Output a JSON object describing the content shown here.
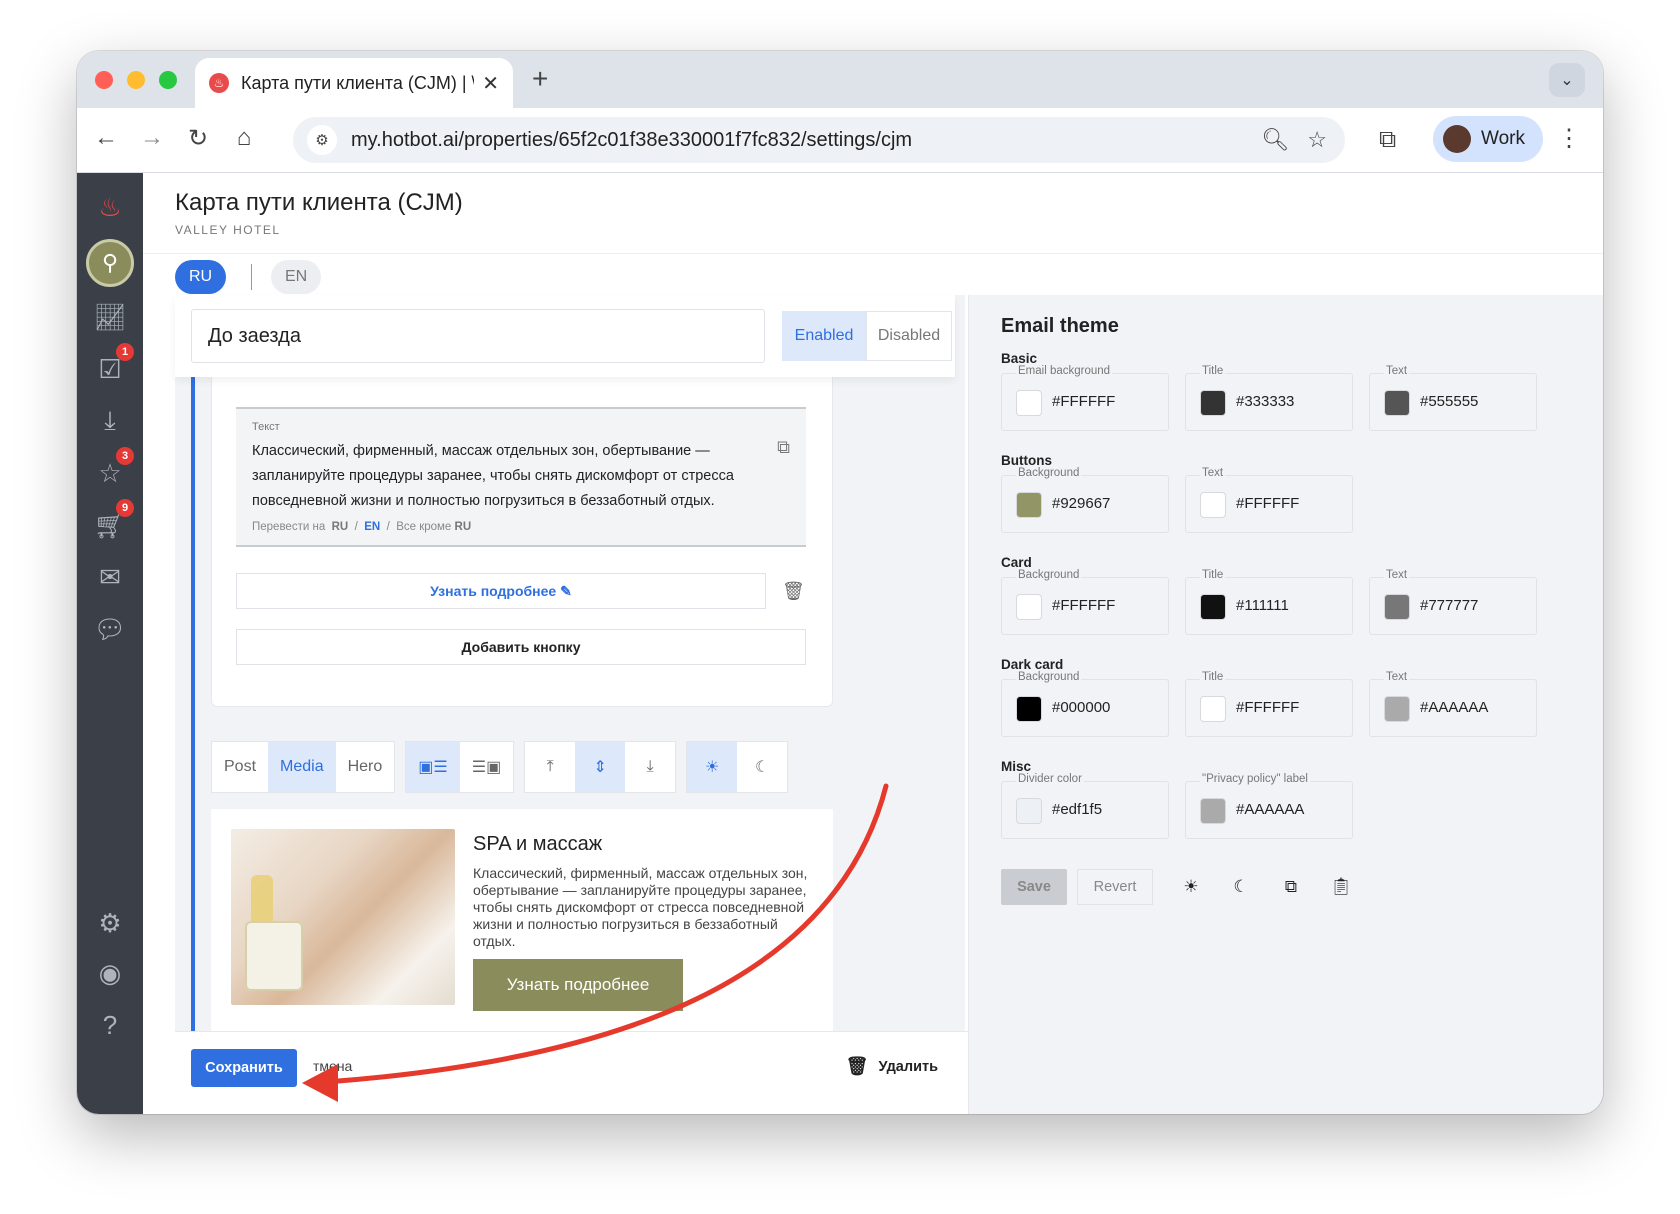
{
  "browser": {
    "tab_title": "Карта пути клиента (CJM) | \\",
    "tab_close": "✕",
    "new_tab": "+",
    "url": "my.hotbot.ai/properties/65f2c01f38e330001f7fc832/settings/cjm",
    "profile_label": "Work"
  },
  "sidebar": {
    "badges": {
      "tasks": "1",
      "reviews": "3",
      "orders": "9"
    }
  },
  "header": {
    "title": "Карта пути клиента (CJM)",
    "subtitle": "VALLEY HOTEL"
  },
  "languages": {
    "active": "RU",
    "other": "EN"
  },
  "stage": {
    "name": "До заезда",
    "enabled_label": "Enabled",
    "disabled_label": "Disabled"
  },
  "text_block": {
    "label": "Текст",
    "body": "Классический, фирменный, массаж отдельных зон, обертывание — запланируйте процедуры заранее, чтобы снять дискомфорт от стресса повседневной жизни и полностью погрузиться в беззаботный отдых.",
    "translate_prefix": "Перевести на",
    "translate_ru": "RU",
    "translate_sep": "/",
    "translate_en": "EN",
    "translate_all_prefix": "Все кроме",
    "translate_all_lang": "RU"
  },
  "buttons": {
    "more_label": "Узнать подробнее ✎",
    "add_label": "Добавить кнопку"
  },
  "layout_toolbar": {
    "post": "Post",
    "media": "Media",
    "hero": "Hero"
  },
  "preview": {
    "title": "SPA и массаж",
    "text": "Классический, фирменный, массаж отдельных зон, обертывание — запланируйте процедуры заранее, чтобы снять дискомфорт от стресса повседневной жизни и полностью погрузиться в беззаботный отдых.",
    "button": "Узнать подробнее"
  },
  "footer": {
    "save": "Сохранить",
    "hint": "тмена",
    "delete": "Удалить"
  },
  "email_theme": {
    "title": "Email theme",
    "sections": {
      "basic": {
        "title": "Basic",
        "fields": [
          {
            "label": "Email background",
            "value": "#FFFFFF",
            "color": "#FFFFFF"
          },
          {
            "label": "Title",
            "value": "#333333",
            "color": "#333333"
          },
          {
            "label": "Text",
            "value": "#555555",
            "color": "#555555"
          }
        ]
      },
      "buttons": {
        "title": "Buttons",
        "fields": [
          {
            "label": "Background",
            "value": "#929667",
            "color": "#929667"
          },
          {
            "label": "Text",
            "value": "#FFFFFF",
            "color": "#FFFFFF"
          }
        ]
      },
      "card": {
        "title": "Card",
        "fields": [
          {
            "label": "Background",
            "value": "#FFFFFF",
            "color": "#FFFFFF"
          },
          {
            "label": "Title",
            "value": "#111111",
            "color": "#111111"
          },
          {
            "label": "Text",
            "value": "#777777",
            "color": "#777777"
          }
        ]
      },
      "dark_card": {
        "title": "Dark card",
        "fields": [
          {
            "label": "Background",
            "value": "#000000",
            "color": "#000000"
          },
          {
            "label": "Title",
            "value": "#FFFFFF",
            "color": "#FFFFFF"
          },
          {
            "label": "Text",
            "value": "#AAAAAA",
            "color": "#AAAAAA"
          }
        ]
      },
      "misc": {
        "title": "Misc",
        "fields": [
          {
            "label": "Divider color",
            "value": "#edf1f5",
            "color": "#edf1f5"
          },
          {
            "label": "\"Privacy policy\" label",
            "value": "#AAAAAA",
            "color": "#AAAAAA"
          }
        ]
      }
    },
    "save": "Save",
    "revert": "Revert"
  },
  "colors": {
    "accent": "#2f6fe0",
    "brand_olive": "#8a8c5c",
    "annotation_arrow": "#e5392b"
  }
}
